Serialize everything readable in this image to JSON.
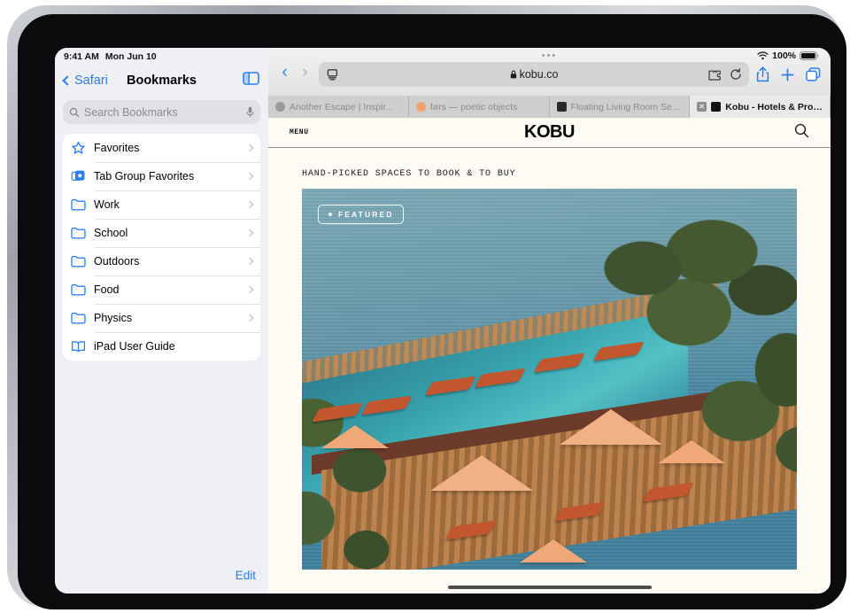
{
  "status": {
    "time": "9:41 AM",
    "date": "Mon Jun 10",
    "battery": "100%"
  },
  "sidebar": {
    "back_label": "Safari",
    "title": "Bookmarks",
    "toggle_icon": "sidebar-toggle-icon",
    "search": {
      "placeholder": "Search Bookmarks",
      "search_icon": "search-icon",
      "mic_icon": "microphone-icon"
    },
    "items": [
      {
        "label": "Favorites",
        "icon": "star-icon",
        "chevron": true
      },
      {
        "label": "Tab Group Favorites",
        "icon": "tab-group-star-icon",
        "chevron": true
      },
      {
        "label": "Work",
        "icon": "folder-icon",
        "chevron": true
      },
      {
        "label": "School",
        "icon": "folder-icon",
        "chevron": true
      },
      {
        "label": "Outdoors",
        "icon": "folder-icon",
        "chevron": true
      },
      {
        "label": "Food",
        "icon": "folder-icon",
        "chevron": true
      },
      {
        "label": "Physics",
        "icon": "folder-icon",
        "chevron": true
      },
      {
        "label": "iPad User Guide",
        "icon": "book-icon",
        "chevron": false
      }
    ],
    "edit_label": "Edit"
  },
  "toolbar": {
    "back_icon": "chevron-left-icon",
    "forward_icon": "chevron-right-icon",
    "page_settings_icon": "page-settings-icon",
    "lock_icon": "lock-icon",
    "url": "kobu.co",
    "extensions_icon": "extensions-puzzle-icon",
    "reload_icon": "reload-icon",
    "share_icon": "share-icon",
    "new_tab_icon": "plus-icon",
    "tabs_overview_icon": "tabs-overview-icon"
  },
  "tabs": [
    {
      "label": "Another Escape | Inspir...",
      "favicon_color": "#9a9a9a",
      "active": false,
      "closable": false
    },
    {
      "label": "førs — poetic objects",
      "favicon_color": "#f2a36a",
      "active": false,
      "closable": false
    },
    {
      "label": "Floating Living Room Se...",
      "favicon_color": "#2b2b2b",
      "active": false,
      "closable": false
    },
    {
      "label": "Kobu - Hotels & Propert...",
      "favicon_color": "#111111",
      "active": true,
      "closable": true
    }
  ],
  "webpage": {
    "menu_label": "MENU",
    "brand": "KOBU",
    "search_icon": "search-icon",
    "tagline": "HAND-PICKED SPACES TO BOOK & TO BUY",
    "hero": {
      "badge_label": "FEATURED",
      "alt": "Cliffside infinity pool with orange umbrellas and loungers overlooking the ocean"
    }
  },
  "colors": {
    "accent_blue": "#2b7cf7",
    "page_bg": "#fdfbf4",
    "sidebar_bg": "#eef0f5",
    "sea": "#6d9cab",
    "pool": "#36a0ab",
    "umbrella": "#f0a878",
    "deck": "#bd8450"
  }
}
